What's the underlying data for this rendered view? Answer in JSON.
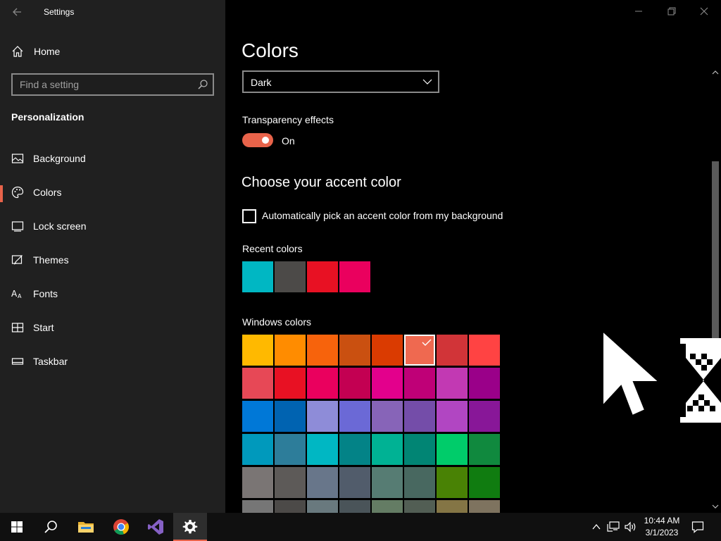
{
  "window": {
    "title": "Settings"
  },
  "sidebar": {
    "home_label": "Home",
    "search_placeholder": "Find a setting",
    "section_title": "Personalization",
    "items": [
      {
        "label": "Background",
        "icon": "picture-icon"
      },
      {
        "label": "Colors",
        "icon": "palette-icon",
        "active": true
      },
      {
        "label": "Lock screen",
        "icon": "lock-screen-icon"
      },
      {
        "label": "Themes",
        "icon": "themes-icon"
      },
      {
        "label": "Fonts",
        "icon": "fonts-icon"
      },
      {
        "label": "Start",
        "icon": "start-icon"
      },
      {
        "label": "Taskbar",
        "icon": "taskbar-icon"
      }
    ]
  },
  "main": {
    "title": "Colors",
    "mode_dropdown": {
      "selected": "Dark"
    },
    "transparency": {
      "label": "Transparency effects",
      "state": "On"
    },
    "accent_heading": "Choose your accent color",
    "auto_pick": {
      "label": "Automatically pick an accent color from my background",
      "checked": false
    },
    "recent_label": "Recent colors",
    "recent_colors": [
      "#00b7c3",
      "#4c4a48",
      "#e81123",
      "#ea005e"
    ],
    "windows_label": "Windows colors",
    "windows_colors": [
      [
        "#ffb900",
        "#ff8c00",
        "#f7630c",
        "#ca5010",
        "#da3b01",
        "#ef6950",
        "#d13438",
        "#ff4343"
      ],
      [
        "#e74856",
        "#e81123",
        "#ea005e",
        "#c30052",
        "#e3008c",
        "#bf0077",
        "#c239b3",
        "#9a0089"
      ],
      [
        "#0078d7",
        "#0063b1",
        "#8e8cd8",
        "#6b69d6",
        "#8764b8",
        "#744da9",
        "#b146c2",
        "#881798"
      ],
      [
        "#0099bc",
        "#2d7d9a",
        "#00b7c3",
        "#038387",
        "#00b294",
        "#018574",
        "#00cc6a",
        "#10893e"
      ],
      [
        "#7a7574",
        "#5d5a58",
        "#68768a",
        "#515c6b",
        "#567c73",
        "#486860",
        "#498205",
        "#107c10"
      ],
      [
        "#767676",
        "#4c4a48",
        "#69797e",
        "#4a5459",
        "#647c64",
        "#525e54",
        "#847545",
        "#7e735f"
      ]
    ],
    "selected_color": "#ef6950"
  },
  "taskbar": {
    "apps": [
      {
        "name": "start-button",
        "icon": "windows-logo-icon"
      },
      {
        "name": "search-button",
        "icon": "search-icon"
      },
      {
        "name": "file-explorer-button",
        "icon": "folder-icon"
      },
      {
        "name": "chrome-button",
        "icon": "chrome-icon"
      },
      {
        "name": "visual-studio-button",
        "icon": "visual-studio-icon"
      },
      {
        "name": "settings-button",
        "icon": "gear-icon",
        "active": true
      }
    ],
    "time": "10:44 AM",
    "date": "3/1/2023"
  },
  "colors": {
    "accent": "#e8634a",
    "sidebar_bg": "#202020",
    "main_bg": "#000000",
    "taskbar_bg": "#101010"
  }
}
